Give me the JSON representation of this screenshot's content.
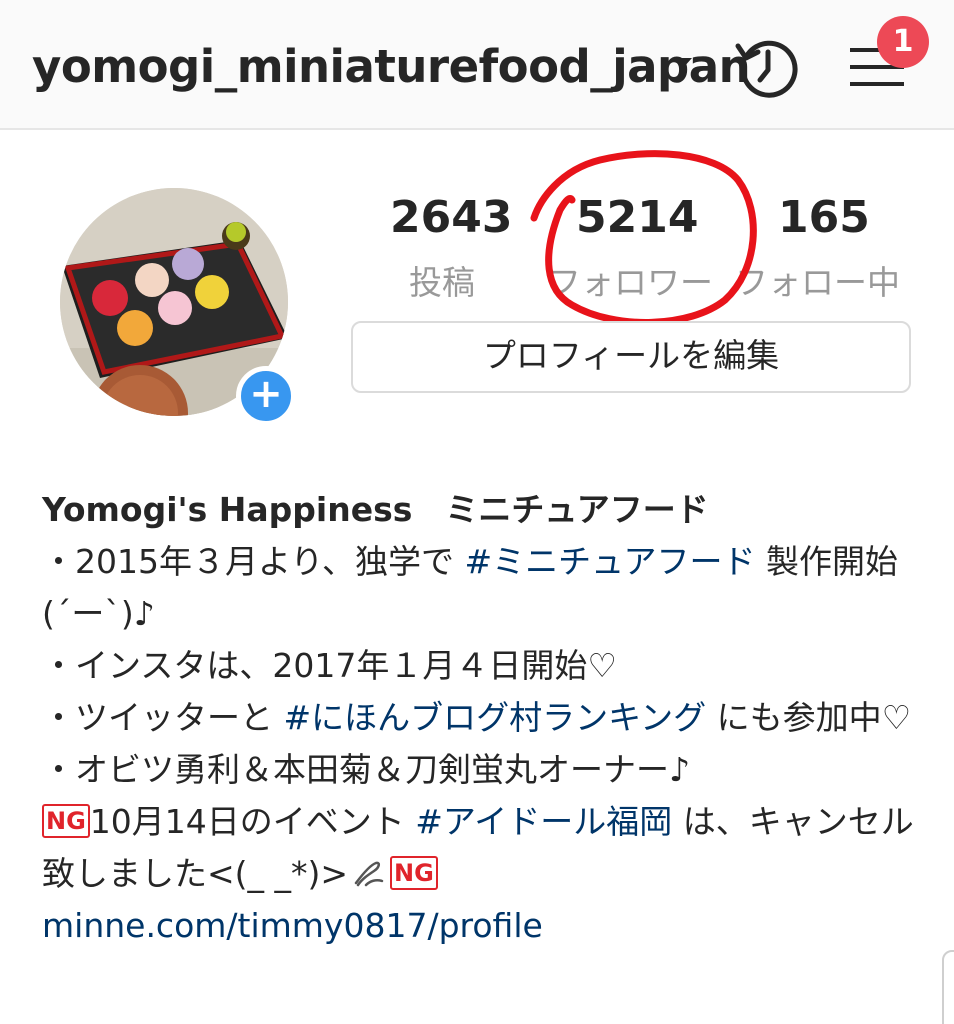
{
  "header": {
    "username": "yomogi_miniaturefood_japan",
    "notification_count": "1"
  },
  "stats": {
    "posts": {
      "value": "2643",
      "label": "投稿"
    },
    "followers": {
      "value": "5214",
      "label": "フォロワー"
    },
    "following": {
      "value": "165",
      "label": "フォロー中"
    }
  },
  "edit_profile_label": "プロフィールを編集",
  "add_story_label": "+",
  "bio": {
    "name": "Yomogi's Happiness　ミニチュアフード",
    "line1_pre": "・2015年３月より、独学で ",
    "line1_tag": "#ミニチュアフード",
    "line1_post": " 製作開始(´ー`)♪",
    "line2": "・インスタは、2017年１月４日開始♡",
    "line3_pre": "・ツイッターと ",
    "line3_tag": "#にほんブログ村ランキング",
    "line3_post": " にも参加中♡",
    "line4": "・オビツ勇利＆本田菊＆刀剣蛍丸オーナー♪",
    "ng_label": "NG",
    "line5_pre": "10月14日のイベント ",
    "line5_tag": "#アイドール福岡",
    "line5_post": " は、キャンセル致しました<(_ _*)>",
    "link": "minne.com/timmy0817/profile"
  },
  "colors": {
    "link": "#003569",
    "badge": "#ed4956",
    "annotation": "#e8131a",
    "add_button": "#3897f0"
  },
  "icons": [
    "dropdown-caret-icon",
    "history-icon",
    "hamburger-menu-icon",
    "add-story-icon",
    "pencil-icon"
  ]
}
